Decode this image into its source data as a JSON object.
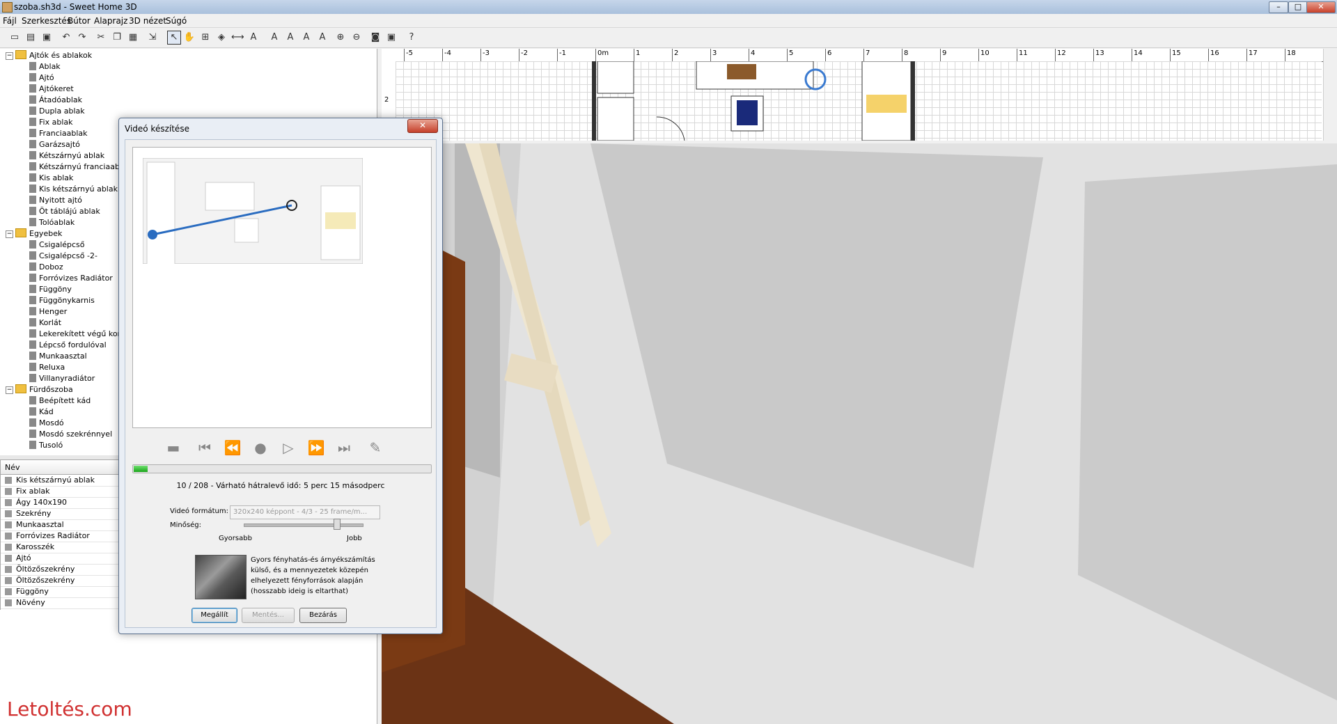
{
  "window": {
    "title": "szoba.sh3d - Sweet Home 3D",
    "controls": {
      "minimize": "–",
      "maximize": "□",
      "close": "✕"
    }
  },
  "menu": [
    "Fájl",
    "Szerkesztés",
    "Bútor",
    "Alaprajz",
    "3D nézet",
    "Súgó"
  ],
  "toolbar_icons": [
    "new-icon",
    "open-icon",
    "save-icon",
    "cut-icon",
    "copy-icon",
    "paste-icon",
    "undo-icon",
    "redo-icon",
    "import-icon",
    "select-icon",
    "pan-icon",
    "create-walls-icon",
    "create-rooms-icon",
    "create-dimensions-icon",
    "add-text-icon",
    "zoom-in-icon",
    "zoom-out-icon",
    "photo-icon",
    "video-icon",
    "help-icon"
  ],
  "catalog": {
    "groups": [
      {
        "label": "Ajtók és ablakok",
        "expander": "−",
        "items": [
          "Ablak",
          "Ajtó",
          "Ajtókeret",
          "Átadóablak",
          "Dupla ablak",
          "Fix ablak",
          "Franciaablak",
          "Garázsajtó",
          "Kétszárnyú ablak",
          "Kétszárnyú franciaablak",
          "Kis ablak",
          "Kis kétszárnyú ablak",
          "Nyitott ajtó",
          "Öt táblájú ablak",
          "Tolóablak"
        ]
      },
      {
        "label": "Egyebek",
        "expander": "−",
        "items": [
          "Csigalépcső",
          "Csigalépcső -2-",
          "Doboz",
          "Forróvizes Radiátor",
          "Függöny",
          "Függönykarnis",
          "Henger",
          "Korlát",
          "Lekerekített végű korlát",
          "Lépcső fordulóval",
          "Munkaasztal",
          "Reluxa",
          "Villanyradiátor"
        ]
      },
      {
        "label": "Fürdőszoba",
        "expander": "−",
        "items": [
          "Beépített kád",
          "Kád",
          "Mosdó",
          "Mosdó szekrénnyel",
          "Tusoló"
        ]
      }
    ]
  },
  "furniture_table": {
    "column": "Név",
    "rows": [
      "Kis kétszárnyú ablak",
      "Fix ablak",
      "Ágy 140x190",
      "Szekrény",
      "Munkaasztal",
      "Forróvizes Radiátor",
      "Karosszék",
      "Ajtó",
      "Öltözőszekrény",
      "Öltözőszekrény",
      "Függöny",
      "Növény"
    ]
  },
  "ruler": {
    "labels": [
      "-5",
      "-4",
      "-3",
      "-2",
      "-1",
      "0m",
      "1",
      "2",
      "3",
      "4",
      "5",
      "6",
      "7",
      "8",
      "9",
      "10",
      "11",
      "12",
      "13",
      "14",
      "15",
      "16",
      "17",
      "18",
      "1"
    ],
    "left_label": "2"
  },
  "watermark": "Letoltés.com",
  "dialog": {
    "title": "Videó készítése",
    "close": "✕",
    "progress": {
      "current": 10,
      "total": 208
    },
    "status": "10 / 208 - Várható hátralevő idő: 5 perc 15 másodperc",
    "format_label": "Videó formátum:",
    "format_value": "320x240 képpont - 4/3 - 25 frame/m...",
    "quality_label": "Minőség:",
    "quality_min": "Gyorsabb",
    "quality_max": "Jobb",
    "quality_level": 0.78,
    "description": "Gyors fényhatás-és árnyékszámítás külső, és a mennyezetek közepén elhelyezett fényforrások alapján (hosszabb ideig is eltarthat)",
    "buttons": {
      "stop": "Megállít",
      "save": "Mentés...",
      "close": "Bezárás"
    }
  }
}
